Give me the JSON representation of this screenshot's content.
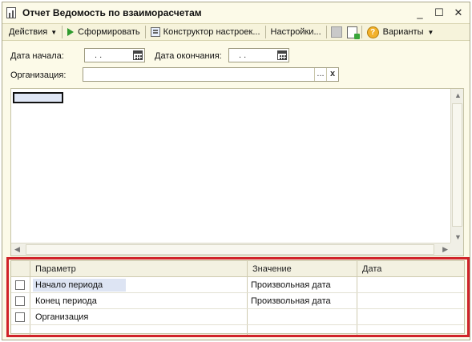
{
  "window": {
    "title": "Отчет  Ведомость по взаиморасчетам",
    "minimize": "_",
    "maximize": "☐",
    "close": "✕"
  },
  "toolbar": {
    "actions": "Действия",
    "generate": "Сформировать",
    "constructor": "Конструктор настроек...",
    "settings": "Настройки...",
    "help": "?",
    "variants": "Варианты"
  },
  "form": {
    "start_date_label": "Дата начала:",
    "start_date_value": " .  .",
    "end_date_label": "Дата окончания:",
    "end_date_value": " .  .",
    "org_label": "Организация:",
    "org_value": "",
    "select_button": "...",
    "clear_button": "x"
  },
  "params": {
    "columns": [
      "Параметр",
      "Значение",
      "Дата"
    ],
    "rows": [
      {
        "param": "Начало периода",
        "value": "Произвольная дата",
        "date": ""
      },
      {
        "param": "Конец периода",
        "value": "Произвольная дата",
        "date": ""
      },
      {
        "param": "Организация",
        "value": "",
        "date": ""
      }
    ]
  }
}
